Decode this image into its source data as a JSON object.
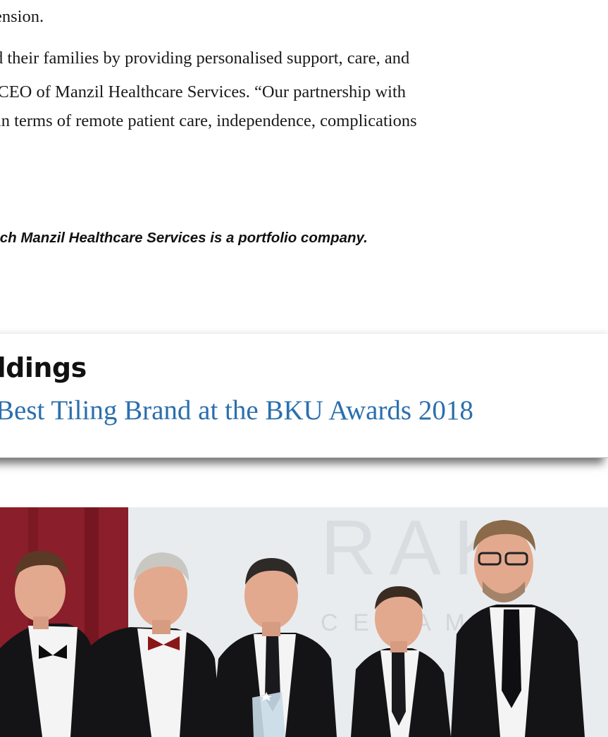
{
  "article": {
    "line1": "ension.",
    "line2": "d their families by providing personalised support, care, and",
    "line3": "o CEO of Manzil Healthcare Services. “Our partnership with",
    "line4": "e in terms of remote patient care, independence, complications",
    "footnote": "ich Manzil Healthcare Services is a portfolio company."
  },
  "banner": {
    "title": "oldings",
    "subtitle": "Best Tiling Brand at the BKU Awards 2018"
  },
  "photo": {
    "backdrop_text": "RAK",
    "backdrop_subtext": "C E R A M I C",
    "colors": {
      "curtain": "#8a1e2a",
      "backdrop": "#e9ecee",
      "suit": "#141416",
      "shirt": "#f4f4f4",
      "skin": "#e2a98e"
    }
  }
}
